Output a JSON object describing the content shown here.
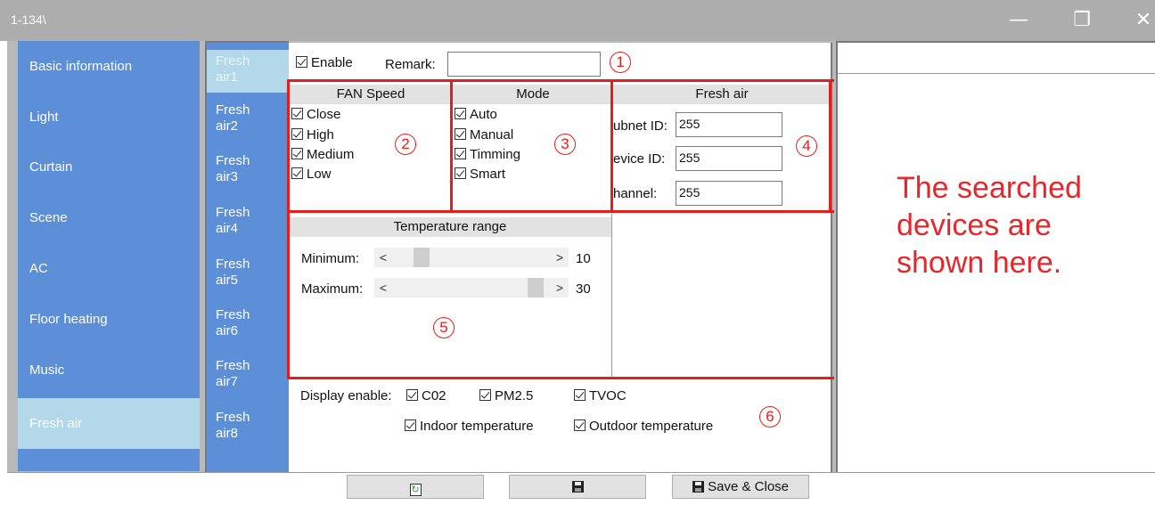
{
  "window": {
    "title": "1-134\\",
    "minimize_glyph": "—",
    "restore_glyph": "❐",
    "close_glyph": "✕"
  },
  "sidebar": {
    "items": [
      {
        "label": "Basic information"
      },
      {
        "label": "Light"
      },
      {
        "label": "Curtain"
      },
      {
        "label": "Scene"
      },
      {
        "label": "AC"
      },
      {
        "label": "Floor heating"
      },
      {
        "label": "Music"
      },
      {
        "label": "Fresh air"
      }
    ],
    "active_index": 7
  },
  "subnav": {
    "items": [
      {
        "line1": "Fresh",
        "line2": "air1"
      },
      {
        "line1": "Fresh",
        "line2": "air2"
      },
      {
        "line1": "Fresh",
        "line2": "air3"
      },
      {
        "line1": "Fresh",
        "line2": "air4"
      },
      {
        "line1": "Fresh",
        "line2": "air5"
      },
      {
        "line1": "Fresh",
        "line2": "air6"
      },
      {
        "line1": "Fresh",
        "line2": "air7"
      },
      {
        "line1": "Fresh",
        "line2": "air8"
      }
    ],
    "active_index": 0
  },
  "top": {
    "enable_label": "Enable",
    "enable_checked": true,
    "remark_label": "Remark:",
    "remark_value": ""
  },
  "fan_speed": {
    "header": "FAN Speed",
    "options": [
      {
        "label": "Close",
        "checked": true
      },
      {
        "label": "High",
        "checked": true
      },
      {
        "label": "Medium",
        "checked": true
      },
      {
        "label": "Low",
        "checked": true
      }
    ]
  },
  "mode": {
    "header": "Mode",
    "options": [
      {
        "label": "Auto",
        "checked": true
      },
      {
        "label": "Manual",
        "checked": true
      },
      {
        "label": "Timming",
        "checked": true
      },
      {
        "label": "Smart",
        "checked": true
      }
    ]
  },
  "fresh_air": {
    "header": "Fresh air",
    "subnet_label": "ubnet ID:",
    "subnet_value": "255",
    "device_label": "evice ID:",
    "device_value": "255",
    "channel_label": "hannel:",
    "channel_value": "255"
  },
  "temperature": {
    "header": "Temperature range",
    "min_label": "Minimum:",
    "min_value": "10",
    "min_fraction": 0.15,
    "max_label": "Maximum:",
    "max_value": "30",
    "max_fraction": 0.95,
    "left_arrow": "<",
    "right_arrow": ">"
  },
  "display": {
    "label": "Display enable:",
    "co2_label": "C02",
    "co2_checked": true,
    "pm25_label": "PM2.5",
    "pm25_checked": true,
    "tvoc_label": "TVOC",
    "tvoc_checked": true,
    "indoor_label": "Indoor temperature",
    "indoor_checked": true,
    "outdoor_label": "Outdoor temperature",
    "outdoor_checked": true
  },
  "annotations": {
    "n1": "1",
    "n2": "2",
    "n3": "3",
    "n4": "4",
    "n5": "5",
    "n6": "6",
    "color": "#e61d1d"
  },
  "right_panel": {
    "note": "The searched devices are shown here."
  },
  "buttons": {
    "refresh_icon": "refresh-icon",
    "save_icon": "save-icon",
    "save_close_label": "Save & Close"
  },
  "colors": {
    "sidebar_bg": "#5d8fd9",
    "sidebar_active": "#b2d8e9",
    "titlebar": "#adadad",
    "accent_red": "#e61d1d"
  }
}
